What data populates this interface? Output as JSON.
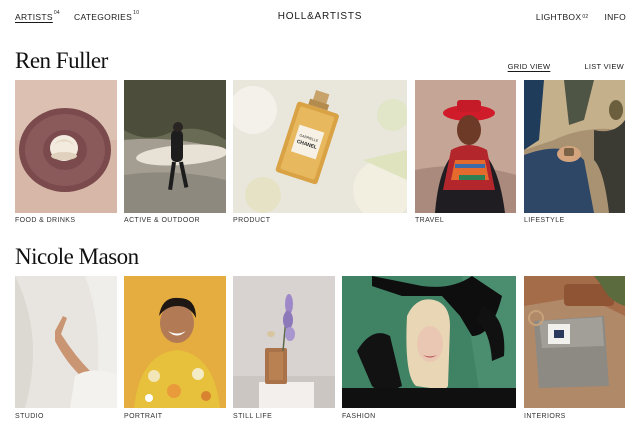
{
  "nav": {
    "artists": {
      "label": "ARTISTS",
      "count": "04"
    },
    "categories": {
      "label": "CATEGORIES",
      "count": "10"
    },
    "brand": "HOLL&ARTISTS",
    "lightbox": {
      "label": "LIGHTBOX",
      "count": "02"
    },
    "info": "INFO"
  },
  "view": {
    "grid": "GRID VIEW",
    "list": "LIST VIEW"
  },
  "artists": [
    {
      "name": "Ren Fuller",
      "categories": [
        "FOOD & DRINKS",
        "ACTIVE & OUTDOOR",
        "PRODUCT",
        "TRAVEL",
        "LIFESTYLE"
      ]
    },
    {
      "name": "Nicole Mason",
      "categories": [
        "STUDIO",
        "PORTRAIT",
        "STILL LIFE",
        "FASHION",
        "INTERIORS"
      ]
    }
  ],
  "product_label": {
    "line1": "GABRIELLE",
    "line2": "CHANEL"
  }
}
